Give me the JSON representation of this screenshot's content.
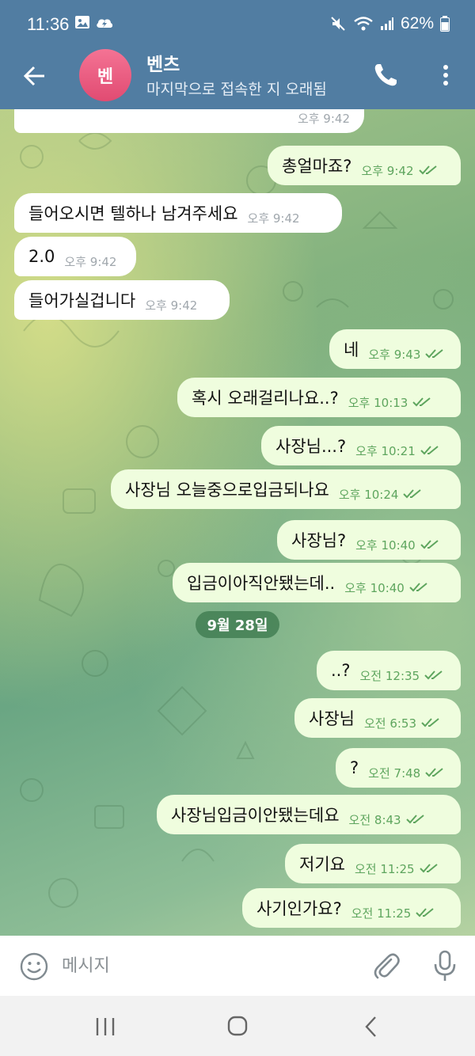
{
  "status_bar": {
    "time": "11:36",
    "battery": "62%"
  },
  "header": {
    "avatar_letter": "벤",
    "contact_name": "벤츠",
    "contact_status": "마지막으로 접속한 지 오래됨"
  },
  "chat": {
    "messages": [
      {
        "dir": "in",
        "text": "",
        "time": "오후 9:42"
      },
      {
        "dir": "out",
        "text": "총얼마죠?",
        "time": "오후 9:42"
      },
      {
        "dir": "in",
        "text": "들어오시면 텔하나 남겨주세요",
        "time": "오후 9:42"
      },
      {
        "dir": "in",
        "text": "2.0",
        "time": "오후 9:42"
      },
      {
        "dir": "in",
        "text": "들어가실겁니다",
        "time": "오후 9:42"
      },
      {
        "dir": "out",
        "text": "네",
        "time": "오후 9:43"
      },
      {
        "dir": "out",
        "text": "혹시 오래걸리나요..?",
        "time": "오후 10:13"
      },
      {
        "dir": "out",
        "text": "사장님...?",
        "time": "오후 10:21"
      },
      {
        "dir": "out",
        "text": "사장님 오늘중으로입금되나요",
        "time": "오후 10:24"
      },
      {
        "dir": "out",
        "text": "사장님?",
        "time": "오후 10:40"
      },
      {
        "dir": "out",
        "text": "입금이아직안됐는데..",
        "time": "오후 10:40"
      },
      {
        "dir": "out",
        "text": "..?",
        "time": "오전 12:35"
      },
      {
        "dir": "out",
        "text": "사장님",
        "time": "오전 6:53"
      },
      {
        "dir": "out",
        "text": "?",
        "time": "오전 7:48"
      },
      {
        "dir": "out",
        "text": "사장님입금이안됐는데요",
        "time": "오전 8:43"
      },
      {
        "dir": "out",
        "text": "저기요",
        "time": "오전 11:25"
      },
      {
        "dir": "out",
        "text": "사기인가요?",
        "time": "오전 11:25"
      }
    ],
    "date_separator": "9월 28일"
  },
  "composer": {
    "placeholder": "메시지"
  },
  "colors": {
    "header_bg": "#517da2",
    "outgoing_bubble": "#effdde",
    "incoming_bubble": "#ffffff",
    "tick_color": "#5ea55e",
    "avatar_color": "#e9587c"
  },
  "icons": [
    "back-arrow-icon",
    "phone-icon",
    "more-vert-icon",
    "emoji-icon",
    "paperclip-icon",
    "microphone-icon",
    "recent-apps-icon",
    "home-icon",
    "nav-back-icon"
  ]
}
